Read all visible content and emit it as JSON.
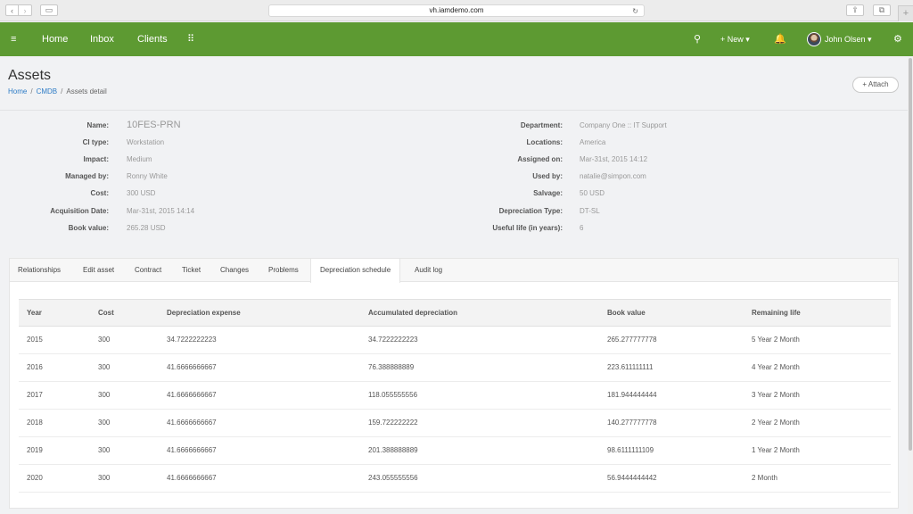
{
  "browser": {
    "url": "vh.iamdemo.com",
    "back_glyph": "‹",
    "forward_glyph": "›",
    "sidebar_glyph": "▭",
    "reload_glyph": "↻",
    "share_glyph": "⇪",
    "tabs_glyph": "⧉",
    "new_tab_glyph": "+"
  },
  "nav": {
    "menu_glyph": "≡",
    "home": "Home",
    "inbox": "Inbox",
    "clients": "Clients",
    "apps_glyph": "⠿",
    "search_glyph": "⚲",
    "new": "+ New ▾",
    "bell_glyph": "🔔",
    "user": "John Olsen ▾",
    "settings_glyph": "⚙",
    "accent_color": "#5d9a32"
  },
  "page": {
    "title": "Assets",
    "breadcrumb": [
      "Home",
      "CMDB",
      "Assets detail"
    ],
    "attach": "+ Attach"
  },
  "details": {
    "left": [
      {
        "label": "Name:",
        "value": "10FES-PRN"
      },
      {
        "label": "CI type:",
        "value": "Workstation"
      },
      {
        "label": "Impact:",
        "value": "Medium"
      },
      {
        "label": "Managed by:",
        "value": "Ronny White"
      },
      {
        "label": "Cost:",
        "value": "300 USD"
      },
      {
        "label": "Acquisition Date:",
        "value": "Mar-31st, 2015 14:14"
      },
      {
        "label": "Book value:",
        "value": "265.28 USD"
      }
    ],
    "right": [
      {
        "label": "Department:",
        "value": "Company One :: IT Support"
      },
      {
        "label": "Locations:",
        "value": "America"
      },
      {
        "label": "Assigned on:",
        "value": "Mar-31st, 2015 14:12"
      },
      {
        "label": "Used by:",
        "value": "natalie@simpon.com"
      },
      {
        "label": "Salvage:",
        "value": "50 USD"
      },
      {
        "label": "Depreciation Type:",
        "value": "DT-SL"
      },
      {
        "label": "Useful life (in years):",
        "value": "6"
      }
    ]
  },
  "tabs": [
    "Relationships",
    "Edit asset",
    "Contract",
    "Ticket",
    "Changes",
    "Problems",
    "Depreciation schedule",
    "Audit log"
  ],
  "active_tab": "Depreciation schedule",
  "table": {
    "headers": [
      "Year",
      "Cost",
      "Depreciation expense",
      "Accumulated depreciation",
      "Book value",
      "Remaining life"
    ],
    "rows": [
      [
        "2015",
        "300",
        "34.7222222223",
        "34.7222222223",
        "265.277777778",
        "5 Year 2 Month"
      ],
      [
        "2016",
        "300",
        "41.6666666667",
        "76.388888889",
        "223.611111111",
        "4 Year 2 Month"
      ],
      [
        "2017",
        "300",
        "41.6666666667",
        "118.055555556",
        "181.944444444",
        "3 Year 2 Month"
      ],
      [
        "2018",
        "300",
        "41.6666666667",
        "159.722222222",
        "140.277777778",
        "2 Year 2 Month"
      ],
      [
        "2019",
        "300",
        "41.6666666667",
        "201.388888889",
        "98.6111111109",
        "1 Year 2 Month"
      ],
      [
        "2020",
        "300",
        "41.6666666667",
        "243.055555556",
        "56.9444444442",
        "2 Month"
      ]
    ]
  }
}
